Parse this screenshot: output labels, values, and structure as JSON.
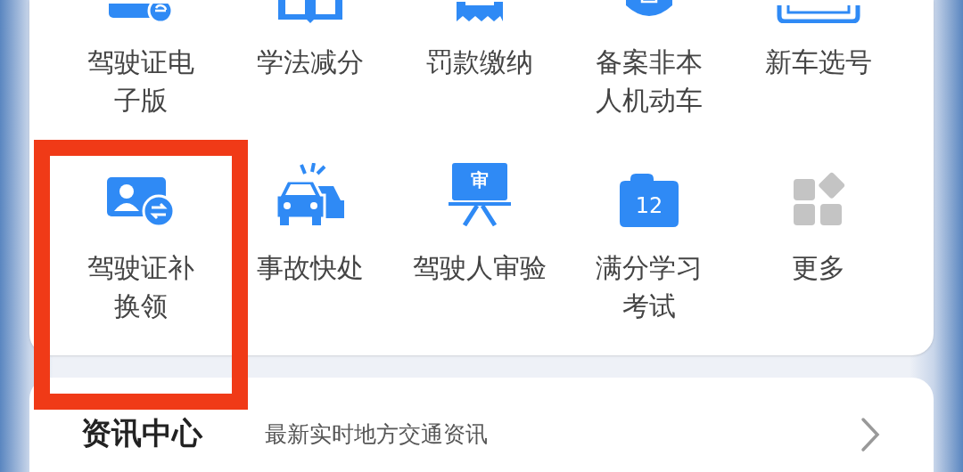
{
  "services": [
    {
      "label": "驾驶证电子版",
      "highlighted": false
    },
    {
      "label": "学法减分",
      "highlighted": false
    },
    {
      "label": "罚款缴纳",
      "highlighted": false
    },
    {
      "label": "备案非本人机动车",
      "highlighted": false
    },
    {
      "label": "新车选号",
      "highlighted": false
    },
    {
      "label": "驾驶证补换领",
      "highlighted": true
    },
    {
      "label": "事故快处",
      "highlighted": false
    },
    {
      "label": "驾驶人审验",
      "highlighted": false,
      "icon_text": "审"
    },
    {
      "label": "满分学习考试",
      "highlighted": false,
      "icon_text": "12"
    },
    {
      "label": "更多",
      "highlighted": false
    }
  ],
  "news": {
    "title": "资讯中心",
    "subtitle": "最新实时地方交通资讯"
  }
}
